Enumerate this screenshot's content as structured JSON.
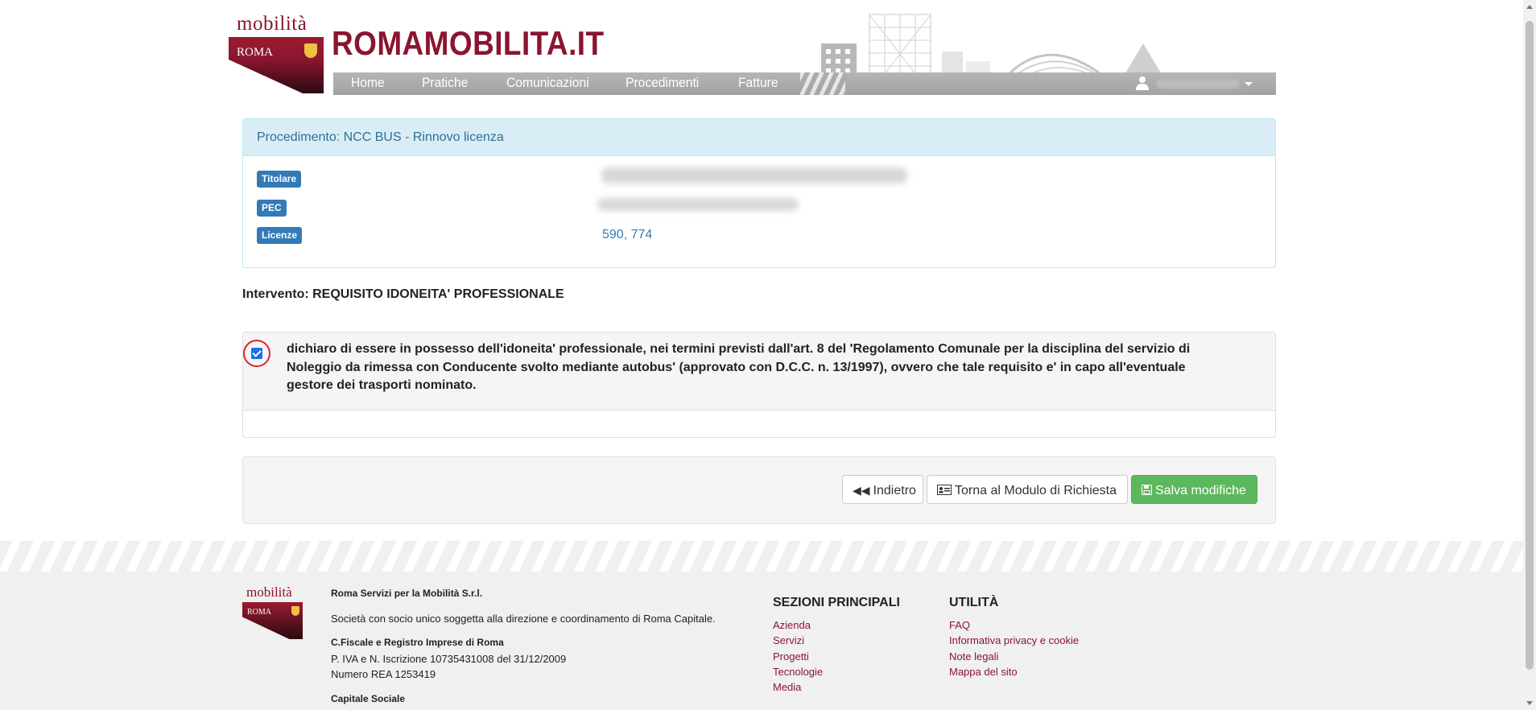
{
  "header": {
    "logo_top": "mobilità",
    "logo_roma": "ROMA",
    "brand_title": "ROMAMOBILITA.IT",
    "nav": [
      "Home",
      "Pratiche",
      "Comunicazioni",
      "Procedimenti",
      "Fatture"
    ]
  },
  "panel": {
    "heading": "Procedimento: NCC BUS - Rinnovo licenza",
    "labels": {
      "titolare": "Titolare",
      "pec": "PEC",
      "licenze": "Licenze"
    },
    "licenze_value": "590, 774"
  },
  "intervento": "Intervento: REQUISITO IDONEITA' PROFESSIONALE",
  "declaration": {
    "checked": true,
    "text": "dichiaro di essere in possesso dell'idoneita' professionale, nei termini previsti dall'art. 8 del 'Regolamento Comunale per la disciplina del servizio di Noleggio da rimessa con Conducente svolto mediante autobus' (approvato con D.C.C. n. 13/1997), ovvero che tale requisito e' in capo all'eventuale gestore dei trasporti nominato."
  },
  "buttons": {
    "back": "Indietro",
    "back_icon": "double-chevron-left-icon",
    "modulo": "Torna al Modulo di Richiesta",
    "modulo_icon": "id-card-icon",
    "save": "Salva modifiche",
    "save_icon": "floppy-disk-icon"
  },
  "footer": {
    "logo_top": "mobilità",
    "logo_roma": "ROMA",
    "company": "Roma Servizi per la Mobilità S.r.l.",
    "socio": "Società con socio unico soggetta alla direzione e coordinamento di Roma Capitale.",
    "fiscale_title": "C.Fiscale e Registro Imprese di Roma",
    "piva": "P. IVA e N. Iscrizione 10735431008 del 31/12/2009",
    "rea": "Numero REA 1253419",
    "capitale": "Capitale Sociale",
    "sezioni_title": "SEZIONI PRINCIPALI",
    "sezioni": [
      "Azienda",
      "Servizi",
      "Progetti",
      "Tecnologie",
      "Media"
    ],
    "utilita_title": "UTILITÀ",
    "utilita": [
      "FAQ",
      "Informativa privacy e cookie",
      "Note legali",
      "Mappa del sito"
    ]
  },
  "colors": {
    "brand": "#8a1530",
    "panel_heading_bg": "#d9edf7",
    "label": "#337ab7",
    "success": "#5cb85c"
  }
}
